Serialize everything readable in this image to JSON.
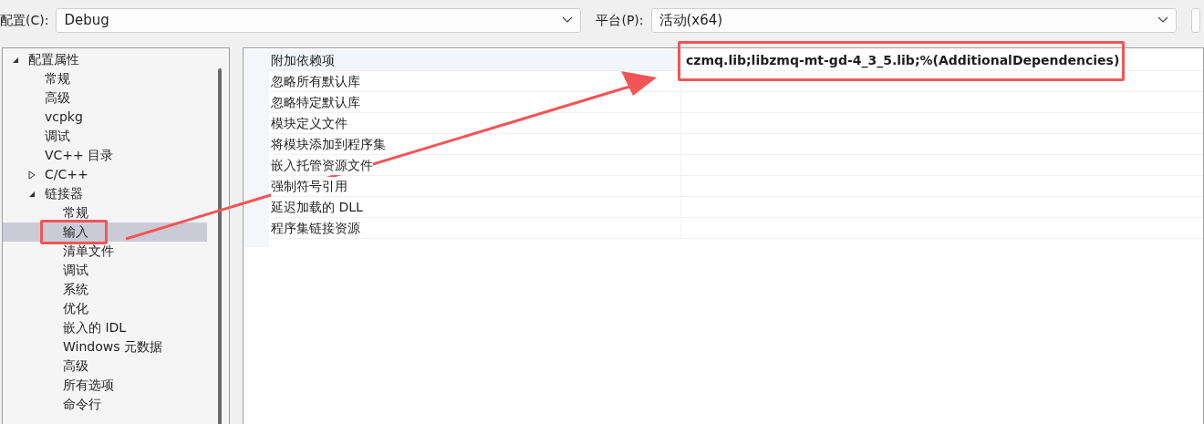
{
  "config": {
    "label": "配置(C):",
    "value": "Debug"
  },
  "platform": {
    "label": "平台(P):",
    "value": "活动(x64)"
  },
  "tree": [
    {
      "label": "配置属性",
      "expanded": true,
      "selected": false,
      "children": [
        {
          "label": "常规",
          "selected": false
        },
        {
          "label": "高级",
          "selected": false
        },
        {
          "label": "vcpkg",
          "selected": false
        },
        {
          "label": "调试",
          "selected": false
        },
        {
          "label": "VC++ 目录",
          "selected": false
        },
        {
          "label": "C/C++",
          "expanded": false,
          "selected": false
        },
        {
          "label": "链接器",
          "expanded": true,
          "selected": false,
          "children": [
            {
              "label": "常规",
              "selected": false
            },
            {
              "label": "输入",
              "selected": true
            },
            {
              "label": "清单文件",
              "selected": false
            },
            {
              "label": "调试",
              "selected": false
            },
            {
              "label": "系统",
              "selected": false
            },
            {
              "label": "优化",
              "selected": false
            },
            {
              "label": "嵌入的 IDL",
              "selected": false
            },
            {
              "label": "Windows 元数据",
              "selected": false
            },
            {
              "label": "高级",
              "selected": false
            },
            {
              "label": "所有选项",
              "selected": false
            },
            {
              "label": "命令行",
              "selected": false
            }
          ]
        }
      ]
    }
  ],
  "properties": [
    {
      "name": "附加依赖项",
      "value": "czmq.lib;libzmq-mt-gd-4_3_5.lib;%(AdditionalDependencies)",
      "selected": true
    },
    {
      "name": "忽略所有默认库",
      "selected": false
    },
    {
      "name": "忽略特定默认库",
      "selected": false
    },
    {
      "name": "模块定义文件",
      "selected": false
    },
    {
      "name": "将模块添加到程序集",
      "selected": false
    },
    {
      "name": "嵌入托管资源文件",
      "selected": false
    },
    {
      "name": "强制符号引用",
      "selected": false
    },
    {
      "name": "延迟加载的 DLL",
      "selected": false
    },
    {
      "name": "程序集链接资源",
      "selected": false
    }
  ]
}
